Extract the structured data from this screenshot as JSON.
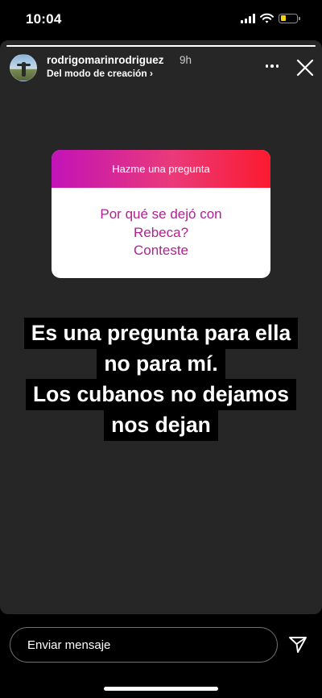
{
  "status_bar": {
    "time": "10:04",
    "icons": [
      "cellular-signal-icon",
      "wifi-icon",
      "battery-icon"
    ],
    "battery_level": 0.35,
    "battery_color": "#f5d20a"
  },
  "story": {
    "progress": 1.0,
    "background": "#262626"
  },
  "header": {
    "username": "rodrigomarinrodriguez",
    "time_ago": "9h",
    "subtitle": "Del modo de creación ›",
    "more_icon": "more-horizontal-icon",
    "close_icon": "close-icon"
  },
  "question_sticker": {
    "header": "Hazme una pregunta",
    "question_lines": [
      "Por qué se dejó con",
      "Rebeca?",
      "Conteste"
    ],
    "gradient_colors": [
      "#c213b8",
      "#ea3a7a",
      "#fb1a2f"
    ],
    "text_color": "#b02191"
  },
  "caption": {
    "lines": [
      "Es una pregunta para ella",
      "no para mí.",
      "Los cubanos no dejamos",
      "nos dejan"
    ]
  },
  "reply": {
    "placeholder": "Enviar mensaje",
    "send_icon": "send-paper-plane-icon"
  }
}
